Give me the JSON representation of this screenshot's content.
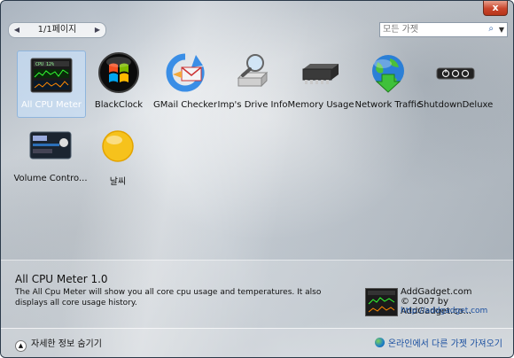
{
  "window": {
    "close_label": "x"
  },
  "pager": {
    "prev_icon": "◀",
    "next_icon": "▶",
    "label": "1/1페이지"
  },
  "search": {
    "placeholder": "모든 가젯",
    "mag_icon": "⌕",
    "drop_icon": "▼"
  },
  "gadgets": [
    {
      "label": "All CPU Meter",
      "icon": "cpu-meter-icon",
      "selected": true
    },
    {
      "label": "BlackClock",
      "icon": "windows-orb-icon"
    },
    {
      "label": "GMail Checker",
      "icon": "mail-refresh-icon"
    },
    {
      "label": "Imp's Drive Info",
      "icon": "drive-magnifier-icon"
    },
    {
      "label": "Memory Usage",
      "icon": "memory-chip-icon"
    },
    {
      "label": "Network Traffic",
      "icon": "globe-download-icon"
    },
    {
      "label": "ShutdownDeluxe",
      "icon": "shutdown-buttons-icon"
    },
    {
      "label": "Volume Contro...",
      "icon": "volume-control-icon"
    },
    {
      "label": "날씨",
      "icon": "sun-icon"
    }
  ],
  "details": {
    "title": "All CPU Meter 1.0",
    "description": "The All Cpu Meter will show you all core cpu usage and temperatures. It also displays all core usage history.",
    "publisher": {
      "name": "AddGadget.com",
      "copyright": "© 2007 by AddGadget.co...",
      "url": "http://addgadget.com"
    }
  },
  "footer": {
    "toggle_icon": "▲",
    "toggle_label": "자세한 정보 숨기기",
    "online_label": "온라인에서 다른 가젯 가져오기"
  }
}
